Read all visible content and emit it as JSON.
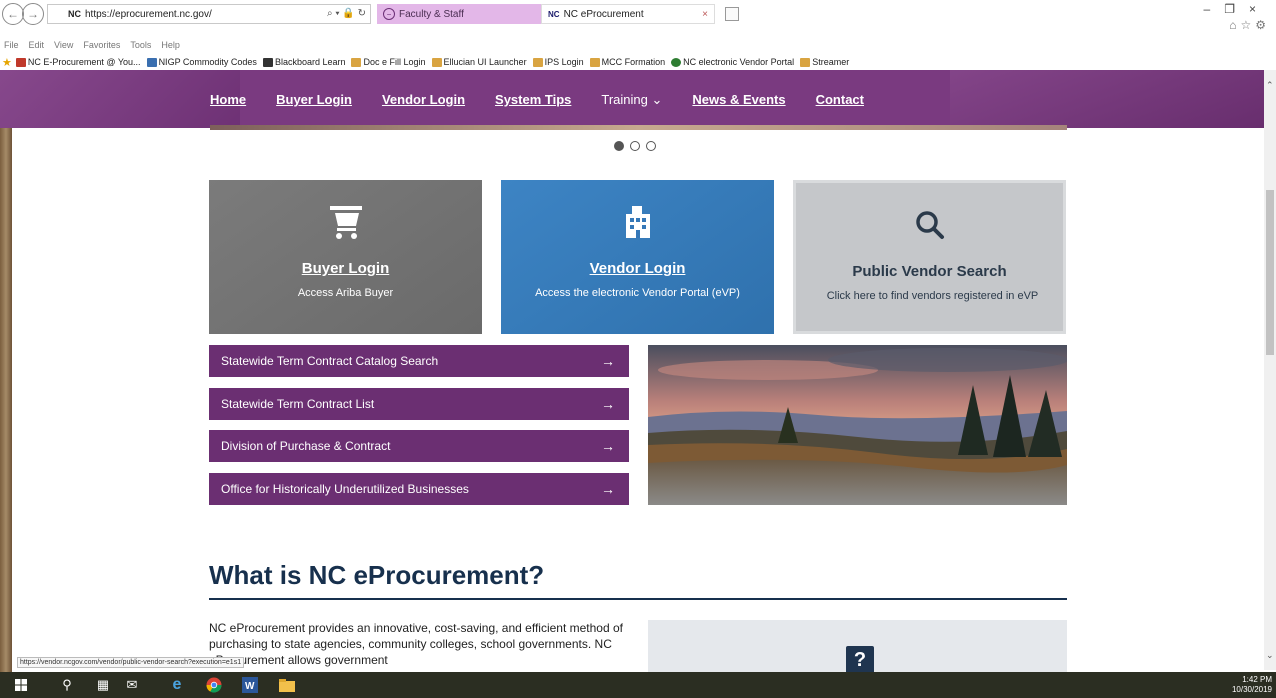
{
  "browser": {
    "url": "https://eprocurement.nc.gov/",
    "url_prefix": "NC",
    "tabs": [
      {
        "label": "Faculty & Staff"
      },
      {
        "label": "NC eProcurement",
        "badge": "NC"
      }
    ],
    "menu": [
      "File",
      "Edit",
      "View",
      "Favorites",
      "Tools",
      "Help"
    ],
    "favorites": [
      {
        "label": "NC E-Procurement @ You...",
        "color": "#c0392b"
      },
      {
        "label": "NIGP Commodity Codes",
        "color": "#3a6fb0"
      },
      {
        "label": "Blackboard Learn",
        "color": "#333333"
      },
      {
        "label": "Doc e Fill Login",
        "color": "#d9a441"
      },
      {
        "label": "Ellucian UI Launcher",
        "color": "#d9a441"
      },
      {
        "label": "IPS Login",
        "color": "#d9a441"
      },
      {
        "label": "MCC Formation",
        "color": "#d9a441"
      },
      {
        "label": "NC electronic Vendor Portal",
        "color": "#2e7d32"
      },
      {
        "label": "Streamer",
        "color": "#d9a441"
      }
    ]
  },
  "nav": {
    "items": [
      {
        "label": "Home"
      },
      {
        "label": "Buyer Login"
      },
      {
        "label": "Vendor Login"
      },
      {
        "label": "System Tips"
      },
      {
        "label": "Training ⌄"
      },
      {
        "label": "News & Events"
      },
      {
        "label": "Contact"
      }
    ]
  },
  "carousel": {
    "slide_count": 3,
    "active": 1
  },
  "cards": {
    "buyer": {
      "title": "Buyer Login",
      "desc": "Access Ariba Buyer"
    },
    "vendor": {
      "title": "Vendor Login",
      "desc": "Access the electronic Vendor Portal (eVP)"
    },
    "search": {
      "title": "Public Vendor Search",
      "desc": "Click here to find vendors registered in eVP"
    }
  },
  "links": [
    {
      "label": "Statewide Term Contract Catalog Search"
    },
    {
      "label": "Statewide Term Contract List"
    },
    {
      "label": "Division of Purchase & Contract"
    },
    {
      "label": "Office for Historically Underutilized Businesses"
    }
  ],
  "link_arrow": "→",
  "about": {
    "title": "What is NC eProcurement?",
    "text": "NC eProcurement provides an innovative, cost-saving, and efficient method of purchasing to state agencies, community colleges, school governments.  NC eProcurement allows government"
  },
  "help_icon": "?",
  "status_url": "https://vendor.ncgov.com/vendor/public-vendor-search?execution=e1s1",
  "taskbar": {
    "time": "1:42 PM",
    "date": "10/30/2019"
  },
  "colors": {
    "purple": "#6b2f72",
    "header": "#7a3a80",
    "blue": "#3d84c4",
    "navy": "#17304d"
  }
}
